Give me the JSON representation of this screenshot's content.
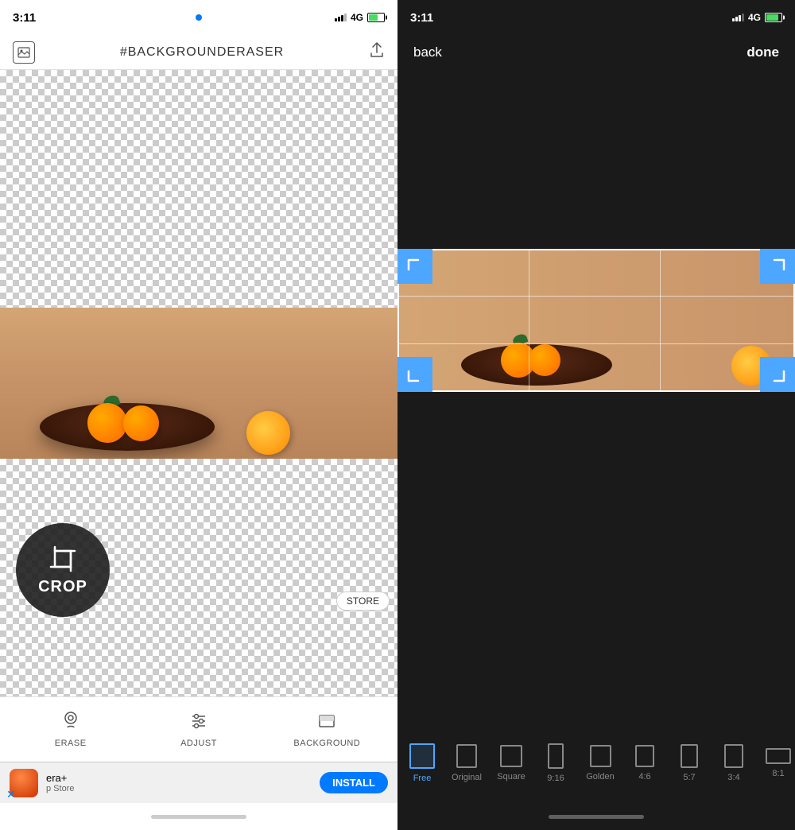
{
  "left": {
    "status": {
      "time": "3:11"
    },
    "header": {
      "title": "#BACKGROUNDERASER"
    },
    "tools": {
      "erase_label": "ERASE",
      "adjust_label": "ADJUST",
      "background_label": "BACKGROUND"
    },
    "store_btn": "STORE",
    "crop_label": "CROP",
    "ad": {
      "title": "era+",
      "subtitle": "p Store",
      "install": "INSTALL"
    }
  },
  "right": {
    "status": {
      "time": "3:11"
    },
    "nav": {
      "back": "back",
      "done": "done"
    },
    "ratios": [
      {
        "label": "Free",
        "box": "free",
        "active": true
      },
      {
        "label": "Original",
        "box": "original",
        "active": false
      },
      {
        "label": "Square",
        "box": "square",
        "active": false
      },
      {
        "label": "9:16",
        "box": "r916",
        "active": false
      },
      {
        "label": "Golden",
        "box": "golden",
        "active": false
      },
      {
        "label": "4:6",
        "box": "r46",
        "active": false
      },
      {
        "label": "5:7",
        "box": "r57",
        "active": false
      },
      {
        "label": "3:4",
        "box": "r34",
        "active": false
      },
      {
        "label": "8:1",
        "box": "r81",
        "active": false
      }
    ]
  }
}
